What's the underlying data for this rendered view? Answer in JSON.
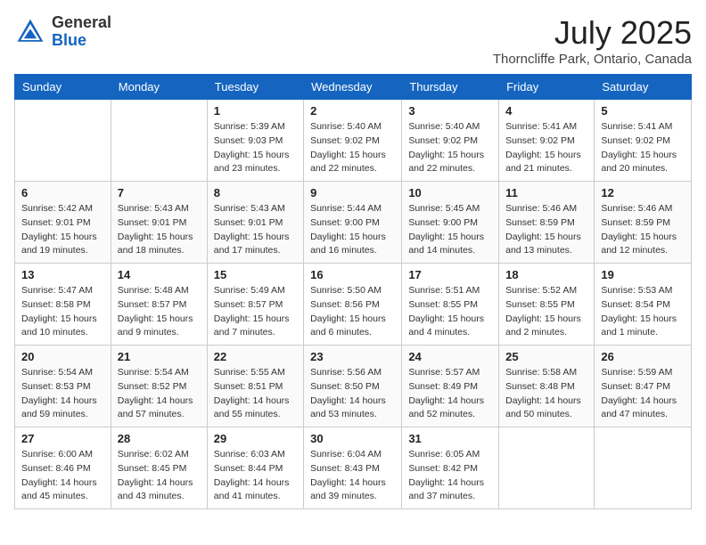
{
  "header": {
    "logo_line1": "General",
    "logo_line2": "Blue",
    "title": "July 2025",
    "subtitle": "Thorncliffe Park, Ontario, Canada"
  },
  "weekdays": [
    "Sunday",
    "Monday",
    "Tuesday",
    "Wednesday",
    "Thursday",
    "Friday",
    "Saturday"
  ],
  "weeks": [
    [
      {
        "day": "",
        "sunrise": "",
        "sunset": "",
        "daylight": ""
      },
      {
        "day": "",
        "sunrise": "",
        "sunset": "",
        "daylight": ""
      },
      {
        "day": "1",
        "sunrise": "Sunrise: 5:39 AM",
        "sunset": "Sunset: 9:03 PM",
        "daylight": "Daylight: 15 hours and 23 minutes."
      },
      {
        "day": "2",
        "sunrise": "Sunrise: 5:40 AM",
        "sunset": "Sunset: 9:02 PM",
        "daylight": "Daylight: 15 hours and 22 minutes."
      },
      {
        "day": "3",
        "sunrise": "Sunrise: 5:40 AM",
        "sunset": "Sunset: 9:02 PM",
        "daylight": "Daylight: 15 hours and 22 minutes."
      },
      {
        "day": "4",
        "sunrise": "Sunrise: 5:41 AM",
        "sunset": "Sunset: 9:02 PM",
        "daylight": "Daylight: 15 hours and 21 minutes."
      },
      {
        "day": "5",
        "sunrise": "Sunrise: 5:41 AM",
        "sunset": "Sunset: 9:02 PM",
        "daylight": "Daylight: 15 hours and 20 minutes."
      }
    ],
    [
      {
        "day": "6",
        "sunrise": "Sunrise: 5:42 AM",
        "sunset": "Sunset: 9:01 PM",
        "daylight": "Daylight: 15 hours and 19 minutes."
      },
      {
        "day": "7",
        "sunrise": "Sunrise: 5:43 AM",
        "sunset": "Sunset: 9:01 PM",
        "daylight": "Daylight: 15 hours and 18 minutes."
      },
      {
        "day": "8",
        "sunrise": "Sunrise: 5:43 AM",
        "sunset": "Sunset: 9:01 PM",
        "daylight": "Daylight: 15 hours and 17 minutes."
      },
      {
        "day": "9",
        "sunrise": "Sunrise: 5:44 AM",
        "sunset": "Sunset: 9:00 PM",
        "daylight": "Daylight: 15 hours and 16 minutes."
      },
      {
        "day": "10",
        "sunrise": "Sunrise: 5:45 AM",
        "sunset": "Sunset: 9:00 PM",
        "daylight": "Daylight: 15 hours and 14 minutes."
      },
      {
        "day": "11",
        "sunrise": "Sunrise: 5:46 AM",
        "sunset": "Sunset: 8:59 PM",
        "daylight": "Daylight: 15 hours and 13 minutes."
      },
      {
        "day": "12",
        "sunrise": "Sunrise: 5:46 AM",
        "sunset": "Sunset: 8:59 PM",
        "daylight": "Daylight: 15 hours and 12 minutes."
      }
    ],
    [
      {
        "day": "13",
        "sunrise": "Sunrise: 5:47 AM",
        "sunset": "Sunset: 8:58 PM",
        "daylight": "Daylight: 15 hours and 10 minutes."
      },
      {
        "day": "14",
        "sunrise": "Sunrise: 5:48 AM",
        "sunset": "Sunset: 8:57 PM",
        "daylight": "Daylight: 15 hours and 9 minutes."
      },
      {
        "day": "15",
        "sunrise": "Sunrise: 5:49 AM",
        "sunset": "Sunset: 8:57 PM",
        "daylight": "Daylight: 15 hours and 7 minutes."
      },
      {
        "day": "16",
        "sunrise": "Sunrise: 5:50 AM",
        "sunset": "Sunset: 8:56 PM",
        "daylight": "Daylight: 15 hours and 6 minutes."
      },
      {
        "day": "17",
        "sunrise": "Sunrise: 5:51 AM",
        "sunset": "Sunset: 8:55 PM",
        "daylight": "Daylight: 15 hours and 4 minutes."
      },
      {
        "day": "18",
        "sunrise": "Sunrise: 5:52 AM",
        "sunset": "Sunset: 8:55 PM",
        "daylight": "Daylight: 15 hours and 2 minutes."
      },
      {
        "day": "19",
        "sunrise": "Sunrise: 5:53 AM",
        "sunset": "Sunset: 8:54 PM",
        "daylight": "Daylight: 15 hours and 1 minute."
      }
    ],
    [
      {
        "day": "20",
        "sunrise": "Sunrise: 5:54 AM",
        "sunset": "Sunset: 8:53 PM",
        "daylight": "Daylight: 14 hours and 59 minutes."
      },
      {
        "day": "21",
        "sunrise": "Sunrise: 5:54 AM",
        "sunset": "Sunset: 8:52 PM",
        "daylight": "Daylight: 14 hours and 57 minutes."
      },
      {
        "day": "22",
        "sunrise": "Sunrise: 5:55 AM",
        "sunset": "Sunset: 8:51 PM",
        "daylight": "Daylight: 14 hours and 55 minutes."
      },
      {
        "day": "23",
        "sunrise": "Sunrise: 5:56 AM",
        "sunset": "Sunset: 8:50 PM",
        "daylight": "Daylight: 14 hours and 53 minutes."
      },
      {
        "day": "24",
        "sunrise": "Sunrise: 5:57 AM",
        "sunset": "Sunset: 8:49 PM",
        "daylight": "Daylight: 14 hours and 52 minutes."
      },
      {
        "day": "25",
        "sunrise": "Sunrise: 5:58 AM",
        "sunset": "Sunset: 8:48 PM",
        "daylight": "Daylight: 14 hours and 50 minutes."
      },
      {
        "day": "26",
        "sunrise": "Sunrise: 5:59 AM",
        "sunset": "Sunset: 8:47 PM",
        "daylight": "Daylight: 14 hours and 47 minutes."
      }
    ],
    [
      {
        "day": "27",
        "sunrise": "Sunrise: 6:00 AM",
        "sunset": "Sunset: 8:46 PM",
        "daylight": "Daylight: 14 hours and 45 minutes."
      },
      {
        "day": "28",
        "sunrise": "Sunrise: 6:02 AM",
        "sunset": "Sunset: 8:45 PM",
        "daylight": "Daylight: 14 hours and 43 minutes."
      },
      {
        "day": "29",
        "sunrise": "Sunrise: 6:03 AM",
        "sunset": "Sunset: 8:44 PM",
        "daylight": "Daylight: 14 hours and 41 minutes."
      },
      {
        "day": "30",
        "sunrise": "Sunrise: 6:04 AM",
        "sunset": "Sunset: 8:43 PM",
        "daylight": "Daylight: 14 hours and 39 minutes."
      },
      {
        "day": "31",
        "sunrise": "Sunrise: 6:05 AM",
        "sunset": "Sunset: 8:42 PM",
        "daylight": "Daylight: 14 hours and 37 minutes."
      },
      {
        "day": "",
        "sunrise": "",
        "sunset": "",
        "daylight": ""
      },
      {
        "day": "",
        "sunrise": "",
        "sunset": "",
        "daylight": ""
      }
    ]
  ]
}
